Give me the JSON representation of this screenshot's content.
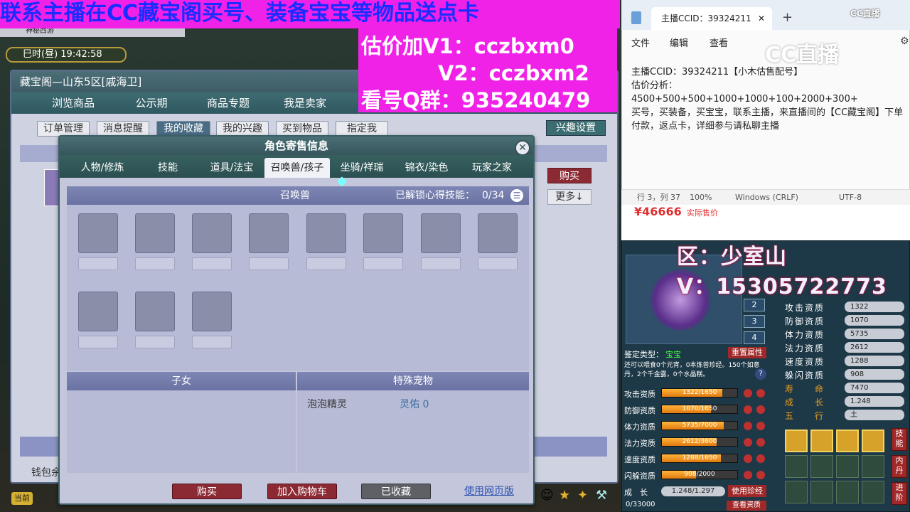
{
  "banner": {
    "line1": "联系主播在CC藏宝阁买号、装备宝宝等物品送点卡",
    "v1": "估价加V1：cczbxm0",
    "v2": "V2：cczbxm2",
    "qq": "看号Q群：935240479"
  },
  "hud": {
    "time": "巳时(昼) 19:42:58",
    "tab_title": "神秘西游"
  },
  "main_window": {
    "title": "藏宝阁—山东5区[戚海卫]",
    "tabs": [
      "浏览商品",
      "公示期",
      "商品专题",
      "我是卖家"
    ],
    "subtabs": [
      "订单管理",
      "消息提醒",
      "我的收藏",
      "我的兴趣",
      "买到物品",
      "指定我"
    ],
    "interest_btn": "兴趣设置",
    "buy_btn": "购买",
    "more_btn": "更多↓",
    "wallet": "钱包余"
  },
  "dialog": {
    "title": "角色寄售信息",
    "tabs": [
      "人物/修炼",
      "技能",
      "道具/法宝",
      "召唤兽/孩子",
      "坐骑/祥瑞",
      "锦衣/染色",
      "玩家之家"
    ],
    "section_title": "召唤兽",
    "unlock_label": "已解锁心得技能：",
    "unlock_value": "0/34",
    "children_title": "子女",
    "special_title": "特殊宠物",
    "special_pet_name": "泡泡精灵",
    "special_pet_value": "灵佑 0",
    "buttons": {
      "buy": "购买",
      "add_cart": "加入购物车",
      "favorited": "已收藏",
      "web": "使用网页版"
    }
  },
  "notepad": {
    "tab_title": "主播CCID：39324211",
    "menu": [
      "文件",
      "编辑",
      "查看"
    ],
    "content": "主播CCID：39324211【小木估售配号】\n估价分析：\n4500+500+500+1000+1000+100+2000+300+\n买号，买装备，买宝宝，联系主播，来直播间的【CC藏宝阁】下单付款，返点卡，详细参与请私聊主播",
    "status": [
      "行 3，列 37",
      "100%",
      "Windows (CRLF)",
      "UTF-8"
    ],
    "price": "¥46666",
    "price_note": "实际售价"
  },
  "pet_panel": {
    "overlay_area": "区：少室山",
    "overlay_v": "V：15305722773",
    "level_buttons": [
      "2",
      "3",
      "4"
    ],
    "identify_label": "鉴定类型：",
    "identify_value": "宝宝",
    "reset_btn": "重置属性",
    "desc": "还可以喂食0个元宵，0本炼兽珍经。150个如意丹，2个千金露，0个水晶糕。",
    "stats": [
      {
        "label": "攻击资质",
        "value": "1322/1650",
        "fill": 0.8
      },
      {
        "label": "防御资质",
        "value": "1070/1650",
        "fill": 0.65
      },
      {
        "label": "体力资质",
        "value": "5735/7000",
        "fill": 0.82
      },
      {
        "label": "法力资质",
        "value": "2612/3600",
        "fill": 0.73
      },
      {
        "label": "速度资质",
        "value": "1288/1650",
        "fill": 0.78
      },
      {
        "label": "闪躲资质",
        "value": "908/2000",
        "fill": 0.45
      }
    ],
    "growth_label": "成　长",
    "growth_value": "1.248/1.297",
    "use_btn": "使用珍经",
    "right_stats": [
      {
        "label": "攻击资质",
        "value": "1322"
      },
      {
        "label": "防御资质",
        "value": "1070"
      },
      {
        "label": "体力资质",
        "value": "5735"
      },
      {
        "label": "法力资质",
        "value": "2612"
      },
      {
        "label": "速度资质",
        "value": "1288"
      },
      {
        "label": "躲闪资质",
        "value": "908"
      },
      {
        "label": "寿　　命",
        "value": "7470"
      },
      {
        "label": "成　　长",
        "value": "1.248"
      },
      {
        "label": "五　　行",
        "value": "土"
      }
    ],
    "side_buttons": [
      "技能",
      "内丹",
      "进阶"
    ],
    "bottom_left": "当前",
    "bottom_num": "0/33000",
    "bottom_btn": "查看资质"
  },
  "watermark": "CC直播",
  "colors": {
    "banner_bg": "#f022e8",
    "banner_text": "#1a2cff",
    "dialog_header": "#3d6168",
    "accent_orange": "#e07a10"
  }
}
